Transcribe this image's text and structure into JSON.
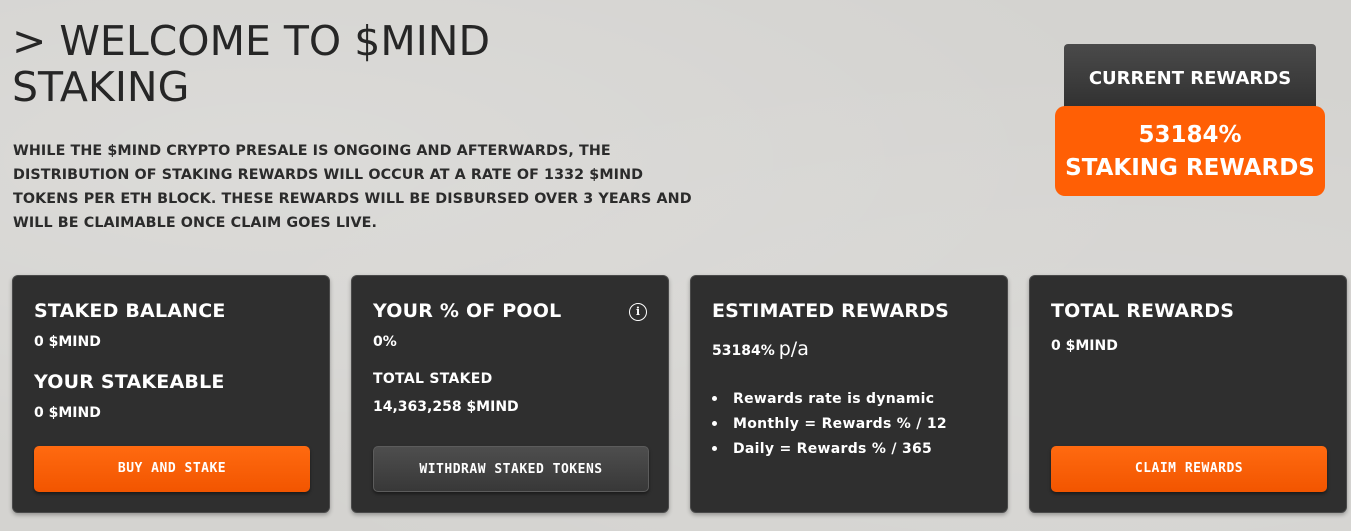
{
  "header": {
    "title": "> WELCOME TO $MIND STAKING",
    "intro": "WHILE THE $MIND CRYPTO PRESALE IS ONGOING AND AFTERWARDS, THE DISTRIBUTION OF STAKING REWARDS WILL OCCUR AT A RATE OF 1332 $MIND TOKENS PER ETH BLOCK. THESE REWARDS WILL BE DISBURSED OVER 3 YEARS AND WILL BE CLAIMABLE ONCE CLAIM GOES LIVE."
  },
  "current_rewards": {
    "tab_label": "CURRENT REWARDS",
    "percent": "53184%",
    "label": "STAKING REWARDS"
  },
  "cards": {
    "staked": {
      "title": "STAKED BALANCE",
      "value": "0  $MIND",
      "stakeable_title": "YOUR STAKEABLE",
      "stakeable_value": "0  $MIND",
      "button": "BUY AND STAKE"
    },
    "pool": {
      "title": "YOUR % OF POOL",
      "info_icon": "i",
      "value": "0%",
      "total_label": "TOTAL STAKED",
      "total_value": "14,363,258  $MIND",
      "button": "WITHDRAW STAKED TOKENS"
    },
    "estimated": {
      "title": "ESTIMATED REWARDS",
      "value": "53184%",
      "unit": "p/a",
      "bullets": [
        "Rewards rate is dynamic",
        "Monthly = Rewards % / 12",
        "Daily = Rewards % / 365"
      ]
    },
    "total": {
      "title": "TOTAL REWARDS",
      "value": "0  $MIND",
      "button": "CLAIM REWARDS"
    }
  },
  "colors": {
    "accent": "#ff5f05",
    "card_bg": "#2f2f2f",
    "page_bg": "#d4d3d0"
  },
  "icons": {
    "info": "info-icon",
    "bullet": "bullet-dot"
  }
}
